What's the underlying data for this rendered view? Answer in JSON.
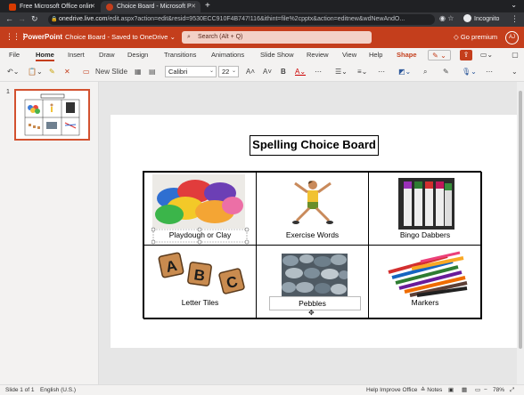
{
  "browser": {
    "tabs": [
      {
        "title": "Free Microsoft Office onlin",
        "favicon_color": "#d83b01"
      },
      {
        "title": "Choice Board - Microsoft P",
        "favicon_color": "#c43e1c"
      }
    ],
    "new_tab": "+",
    "url_host": "onedrive.live.com",
    "url_rest": "/edit.aspx?action=edit&resid=9530ECC910F4B747!116&ithint=file%2cpptx&action=editnew&wdNewAndO...",
    "profile": "Incognito"
  },
  "app": {
    "name": "PowerPoint",
    "doc_title": "Choice Board - Saved to OneDrive",
    "search_placeholder": "Search (Alt + Q)",
    "premium": "Go premium",
    "avatar_initials": "AJ",
    "accent": "#c43e1c"
  },
  "menu": {
    "tabs": [
      "File",
      "Home",
      "Insert",
      "Draw",
      "Design",
      "Transitions",
      "Animations",
      "Slide Show",
      "Review",
      "View",
      "Help",
      "Shape"
    ],
    "active": "Home"
  },
  "ribbon": {
    "new_slide": "New Slide",
    "font_name": "Calibri",
    "font_size": "22"
  },
  "slides_panel": {
    "number": "1"
  },
  "slide": {
    "title": "Spelling Choice Board",
    "cells": [
      {
        "label": "Playdough or Clay"
      },
      {
        "label": "Exercise Words"
      },
      {
        "label": "Bingo Dabbers"
      },
      {
        "label": "Letter Tiles",
        "letters": [
          "A",
          "B",
          "C"
        ]
      },
      {
        "label": "Pebbles"
      },
      {
        "label": "Markers"
      }
    ]
  },
  "status": {
    "slide_info": "Slide 1 of 1",
    "language": "English (U.S.)",
    "help": "Help Improve Office",
    "notes": "Notes",
    "zoom": "78%"
  }
}
